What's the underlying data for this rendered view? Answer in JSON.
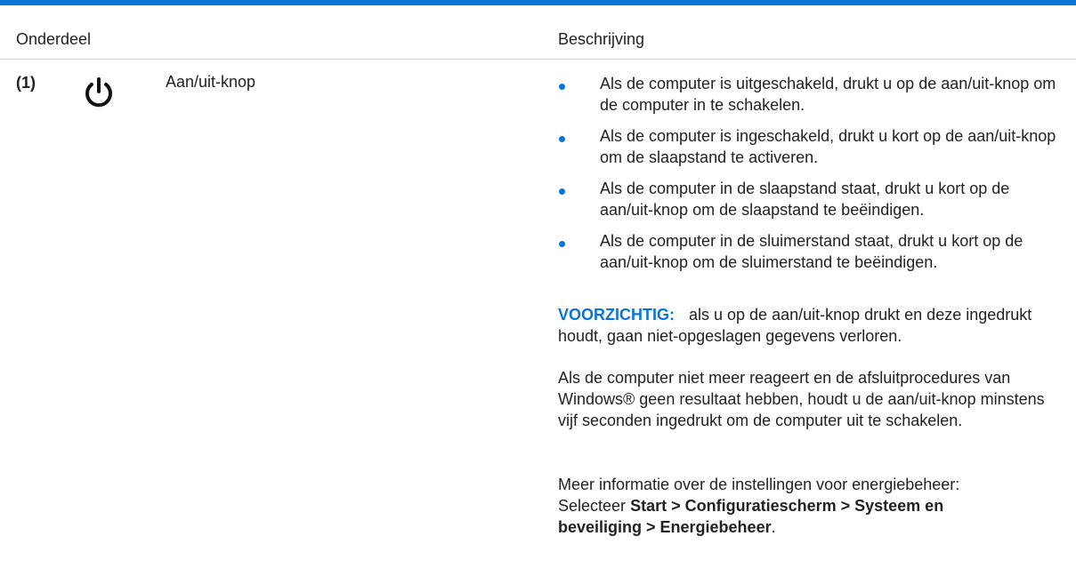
{
  "table": {
    "col_component": "Onderdeel",
    "col_description": "Beschrijving"
  },
  "item": {
    "number": "(1)",
    "icon": "power-icon",
    "name": "Aan/uit-knop",
    "bullets": [
      "Als de computer is uitgeschakeld, drukt u op de aan/uit-knop om de computer in te schakelen.",
      "Als de computer is ingeschakeld, drukt u kort op de aan/uit-knop om de slaapstand te activeren.",
      "Als de computer in de slaapstand staat, drukt u kort op de aan/uit-knop om de slaapstand te beëindigen.",
      "Als de computer in de sluimerstand staat, drukt u kort op de aan/uit-knop om de sluimerstand te beëindigen."
    ],
    "caution_label": "VOORZICHTIG:",
    "caution_text": "als u op de aan/uit-knop drukt en deze ingedrukt houdt, gaan niet-opgeslagen gegevens verloren.",
    "unresponsive_text": "Als de computer niet meer reageert en de afsluitprocedures van Windows® geen resultaat hebben, houdt u de aan/uit-knop minstens vijf seconden ingedrukt om de computer uit te schakelen.",
    "more_info_text": "Meer informatie over de instellingen voor energiebeheer: Selecteer",
    "more_info_path": "Start > Configuratiescherm > Systeem en beveiliging > Energiebeheer",
    "more_info_end": "."
  },
  "colors": {
    "accent": "#0a74d9"
  }
}
